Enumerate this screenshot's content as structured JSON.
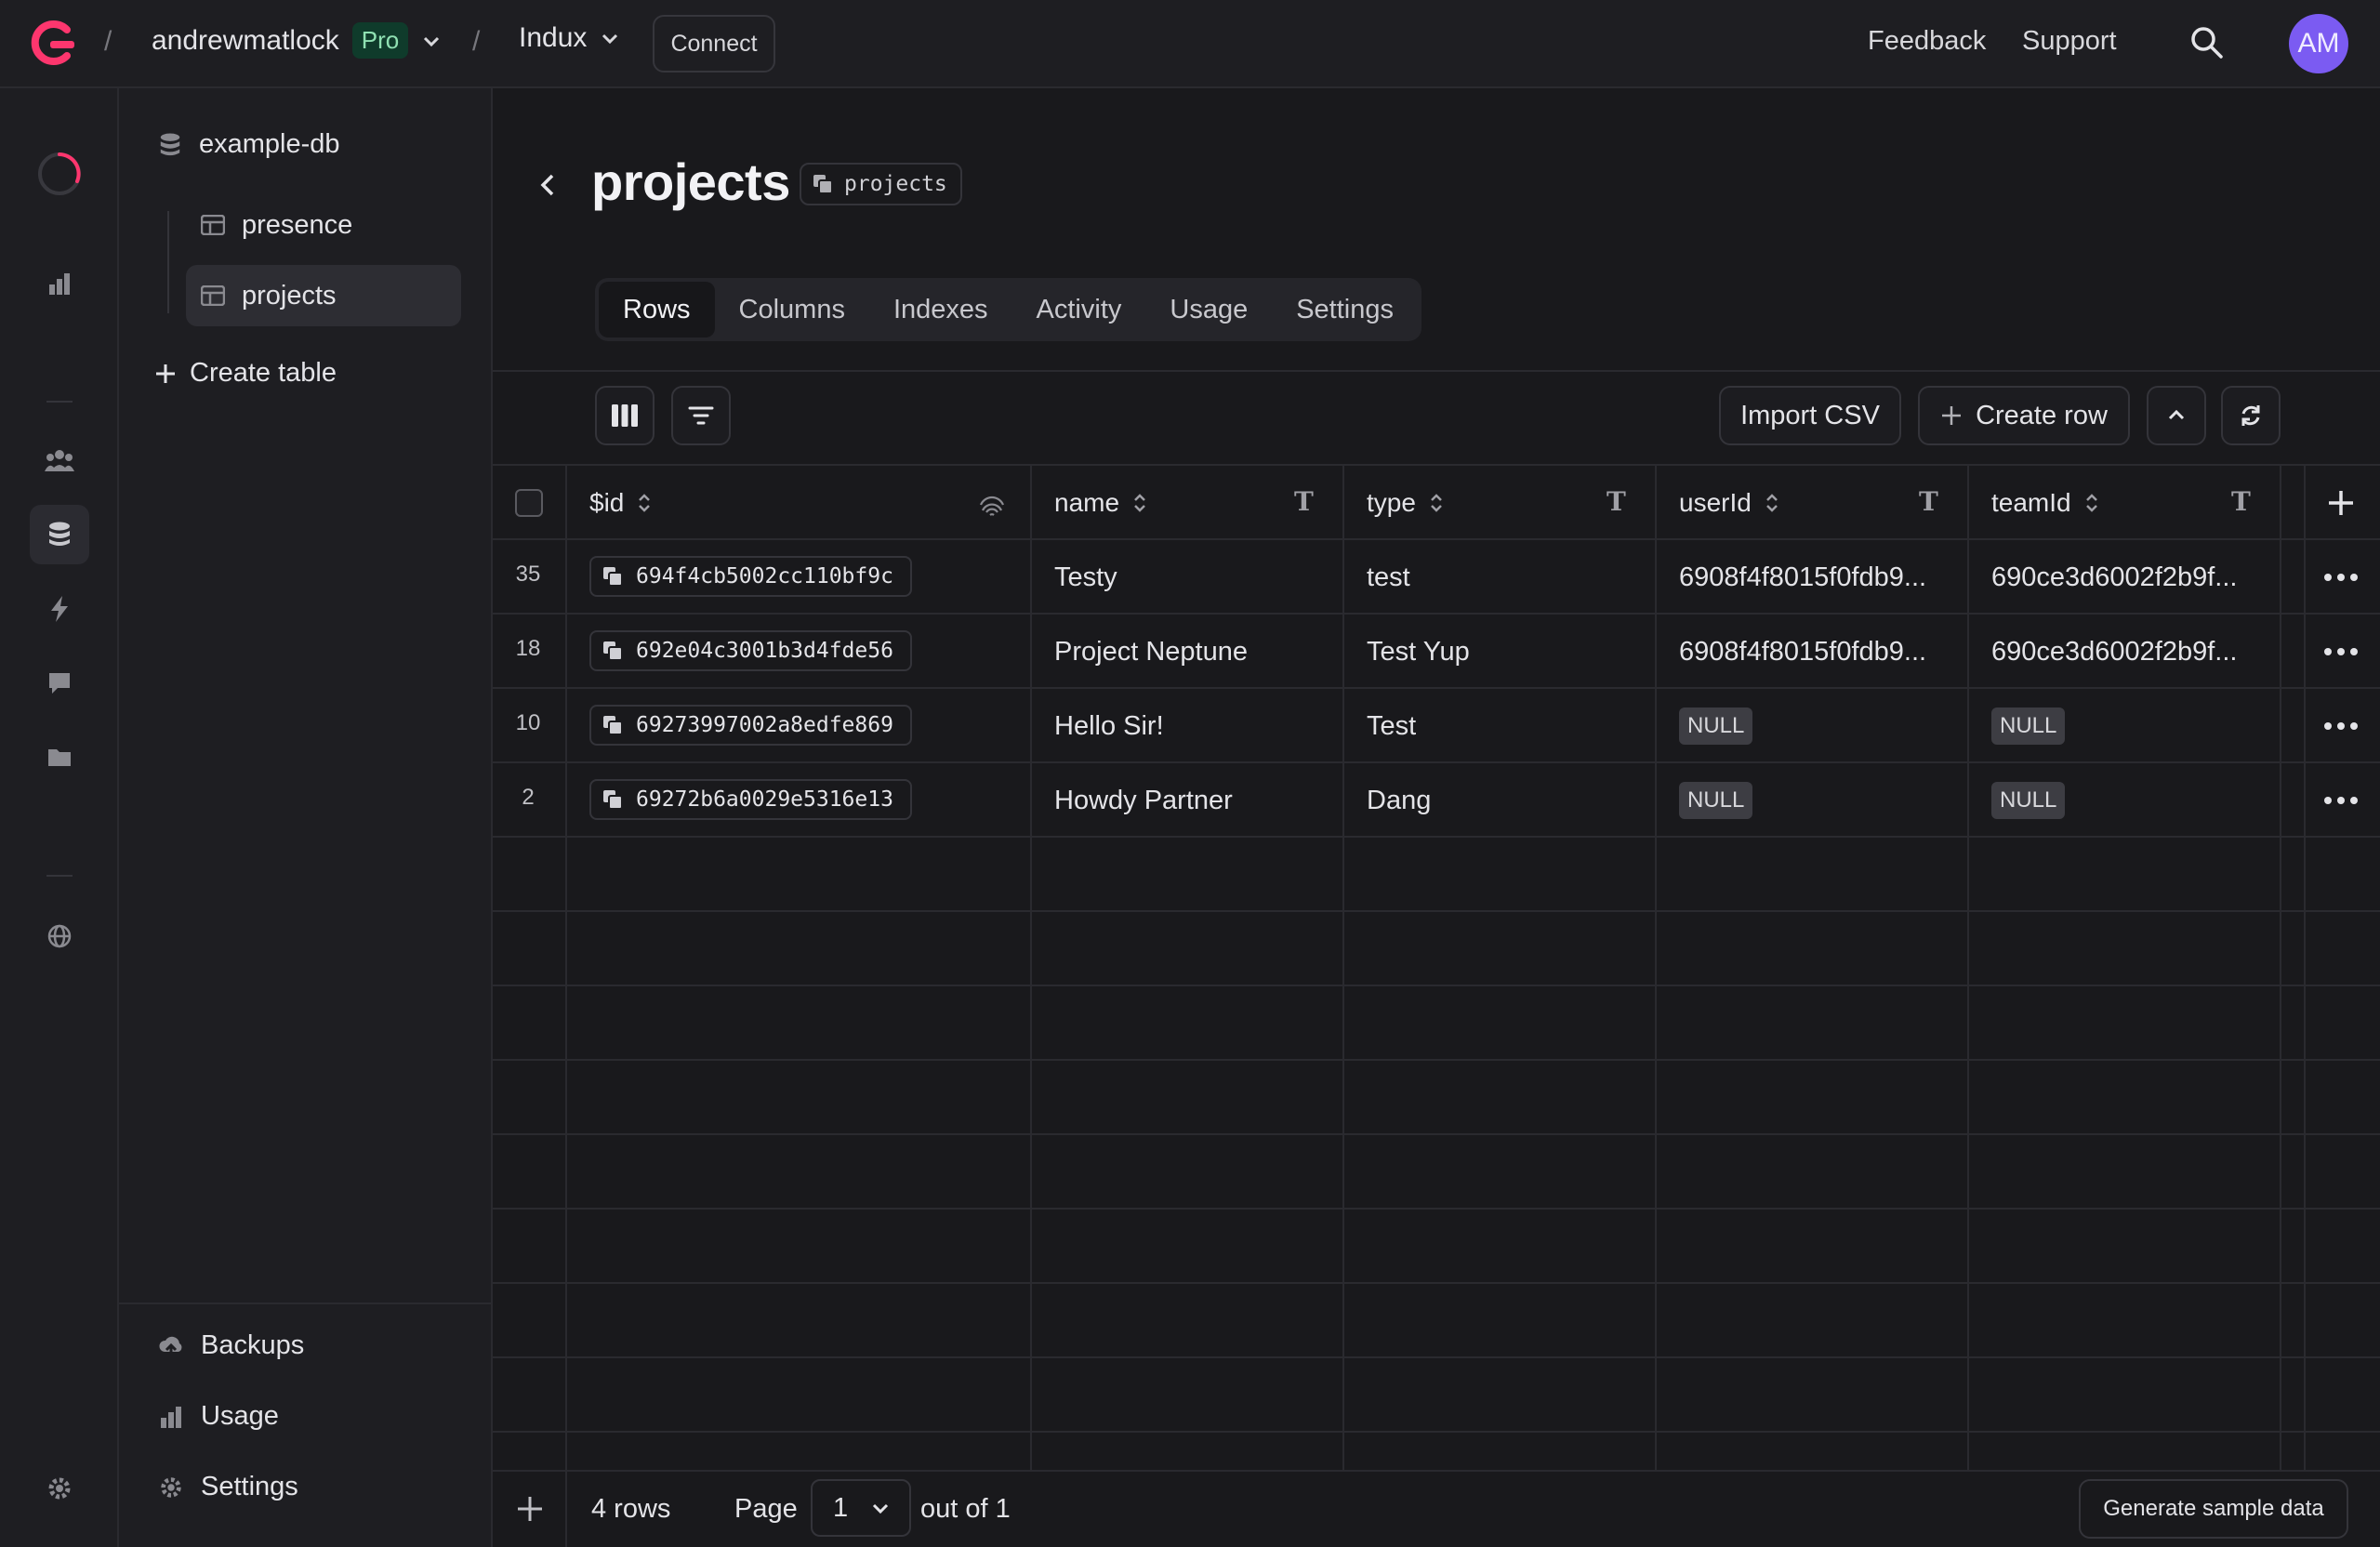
{
  "brand": {
    "logo_icon": "appwrite-logo-icon",
    "accent": "#fd366e"
  },
  "topbar": {
    "separator": "/",
    "org_name": "andrewmatlock",
    "plan_badge": "Pro",
    "project_name": "Indux",
    "connect_label": "Connect",
    "feedback_label": "Feedback",
    "support_label": "Support",
    "avatar_initials": "AM",
    "avatar_color": "#7b5bf2"
  },
  "rail": {
    "icons": [
      "progress-ring-icon",
      "chart-icon",
      "users-icon",
      "database-icon",
      "bolt-icon",
      "message-icon",
      "folder-icon",
      "globe-icon",
      "gear-icon"
    ]
  },
  "sidebar": {
    "database_name": "example-db",
    "tables": [
      {
        "label": "presence"
      },
      {
        "label": "projects"
      }
    ],
    "create_table_label": "Create table",
    "bottom": [
      {
        "label": "Backups"
      },
      {
        "label": "Usage"
      },
      {
        "label": "Settings"
      }
    ]
  },
  "main": {
    "title": "projects",
    "id_chip": "projects",
    "tabs": [
      {
        "label": "Rows"
      },
      {
        "label": "Columns"
      },
      {
        "label": "Indexes"
      },
      {
        "label": "Activity"
      },
      {
        "label": "Usage"
      },
      {
        "label": "Settings"
      }
    ],
    "active_tab": "Rows",
    "toolbar": {
      "import_label": "Import CSV",
      "create_row_label": "Create row"
    }
  },
  "table": {
    "columns": [
      {
        "label": "$id"
      },
      {
        "label": "name",
        "type_icon": "T"
      },
      {
        "label": "type",
        "type_icon": "T"
      },
      {
        "label": "userId",
        "type_icon": "T"
      },
      {
        "label": "teamId",
        "type_icon": "T"
      }
    ],
    "rows": [
      {
        "num": "35",
        "id": "694f4cb5002cc110bf9c",
        "name": "Testy",
        "type": "test",
        "userId": "6908f4f8015f0fdb9...",
        "teamId": "690ce3d6002f2b9f..."
      },
      {
        "num": "18",
        "id": "692e04c3001b3d4fde56",
        "name": "Project Neptune",
        "type": "Test Yup",
        "userId": "6908f4f8015f0fdb9...",
        "teamId": "690ce3d6002f2b9f..."
      },
      {
        "num": "10",
        "id": "69273997002a8edfe869",
        "name": "Hello Sir!",
        "type": "Test",
        "userId": "NULL",
        "teamId": "NULL"
      },
      {
        "num": "2",
        "id": "69272b6a0029e5316e13",
        "name": "Howdy Partner",
        "type": "Dang",
        "userId": "NULL",
        "teamId": "NULL"
      }
    ]
  },
  "footer": {
    "row_count": "4 rows",
    "page_label": "Page",
    "page_value": "1",
    "out_of": "out of 1",
    "generate_label": "Generate sample data"
  }
}
